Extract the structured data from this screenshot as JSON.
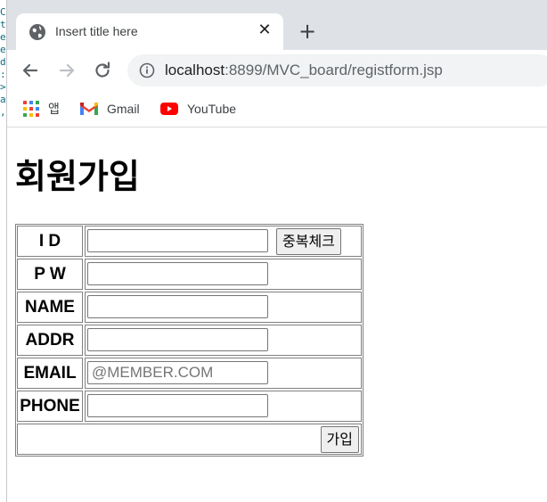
{
  "tab": {
    "title": "Insert title here",
    "globe_icon": "globe-icon",
    "close_glyph": "✕",
    "new_tab_glyph": "+"
  },
  "toolbar": {
    "url_host": "localhost",
    "url_rest": ":8899/MVC_board/registform.jsp"
  },
  "bookmarks": [
    {
      "label": "앱",
      "icon": "apps-grid-icon"
    },
    {
      "label": "Gmail",
      "icon": "gmail-icon"
    },
    {
      "label": "YouTube",
      "icon": "youtube-icon"
    }
  ],
  "page": {
    "title": "회원가입",
    "fields": [
      {
        "label": "I D",
        "value": "",
        "placeholder": ""
      },
      {
        "label": "P W",
        "value": "",
        "placeholder": ""
      },
      {
        "label": "NAME",
        "value": "",
        "placeholder": ""
      },
      {
        "label": "ADDR",
        "value": "",
        "placeholder": ""
      },
      {
        "label": "EMAIL",
        "value": "",
        "placeholder": "@MEMBER.COM"
      },
      {
        "label": "PHONE",
        "value": "",
        "placeholder": ""
      }
    ],
    "dup_check_label": "중복체크",
    "submit_label": "가입"
  },
  "colors": {
    "tabstrip": "#dee1e6",
    "omnibox": "#f1f3f4",
    "youtube_red": "#ff0000"
  }
}
